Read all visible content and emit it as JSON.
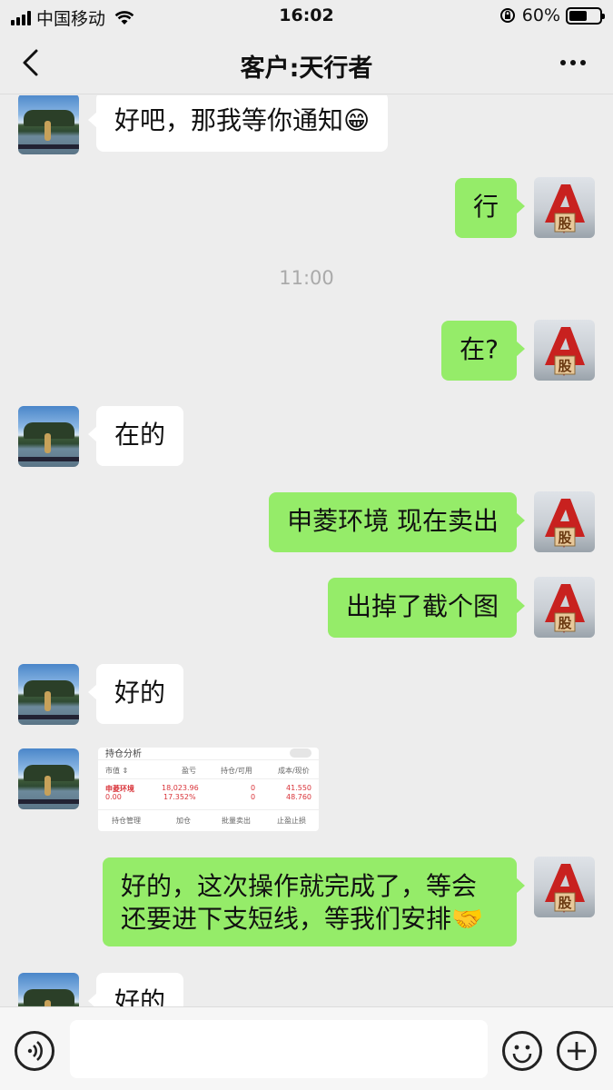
{
  "status_bar": {
    "carrier": "中国移动",
    "time": "16:02",
    "battery": "60%",
    "battery_level": 0.6
  },
  "nav": {
    "title": "客户:天行者",
    "back_icon": "chevron-left-icon",
    "more_icon": "more-dots-icon"
  },
  "messages": [
    {
      "from": "customer",
      "text": "好吧，那我等你通知😁"
    },
    {
      "from": "me",
      "text": "行"
    },
    {
      "type": "timestamp",
      "text": "11:00"
    },
    {
      "from": "me",
      "text": "在?"
    },
    {
      "from": "customer",
      "text": "在的"
    },
    {
      "from": "me",
      "text": "申菱环境 现在卖出"
    },
    {
      "from": "me",
      "text": "出掉了截个图"
    },
    {
      "from": "customer",
      "text": "好的"
    },
    {
      "from": "customer",
      "type": "image"
    },
    {
      "from": "me",
      "text": "好的，这次操作就完成了，等会还要进下支短线，等我们安排🤝"
    },
    {
      "from": "customer",
      "text": "好的"
    }
  ],
  "avatars": {
    "me_label": "股",
    "me_letter": "A"
  },
  "screenshot_card": {
    "header": "持仓分析",
    "columns": [
      "市值 ⇕",
      "盈亏",
      "持仓/可用",
      "成本/现价"
    ],
    "row": {
      "name": "申菱环境",
      "market_value": "0.00",
      "profit": "18,023.96",
      "profit_pct": "17.352%",
      "hold": "0",
      "available": "0",
      "cost": "41.550",
      "price": "48.760"
    },
    "actions": [
      "持仓管理",
      "加仓",
      "批量卖出",
      "止盈止损"
    ]
  },
  "input_bar": {
    "voice_icon": "voice-icon",
    "emoji_icon": "emoji-icon",
    "plus_icon": "plus-icon"
  },
  "colors": {
    "outgoing_bubble": "#95ec69",
    "incoming_bubble": "#ffffff",
    "background": "#ededed",
    "stock_red": "#d9343a"
  }
}
